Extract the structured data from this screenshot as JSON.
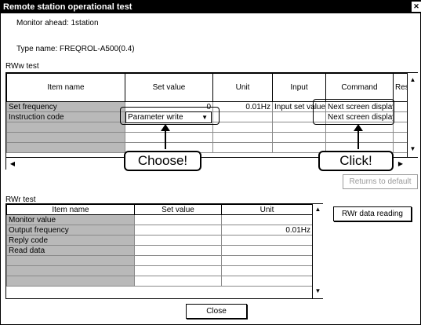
{
  "window": {
    "title": "Remote station operational test",
    "close_glyph": "✕"
  },
  "info": {
    "monitor_ahead": "Monitor ahead:  1station",
    "type_name": "Type name:    FREQROL-A500(0.4)"
  },
  "rww": {
    "section_label": "RWw test",
    "headers": [
      "Item name",
      "Set value",
      "Unit",
      "Input",
      "Command",
      "Res"
    ],
    "rows": [
      {
        "name": "Set frequency",
        "set_value": "0",
        "unit": "0.01Hz",
        "input": "Input set value",
        "command": "Next screen display"
      },
      {
        "name": "Instruction code",
        "set_value": "Parameter write",
        "unit": "",
        "input": "",
        "command": "Next screen display"
      },
      {
        "name": "",
        "set_value": "",
        "unit": "",
        "input": "",
        "command": ""
      },
      {
        "name": "",
        "set_value": "",
        "unit": "",
        "input": "",
        "command": ""
      },
      {
        "name": "",
        "set_value": "",
        "unit": "",
        "input": "",
        "command": ""
      }
    ],
    "returns_button": "Returns to default"
  },
  "callouts": {
    "choose": "Choose!",
    "click": "Click!"
  },
  "rwr": {
    "section_label": "RWr test",
    "headers": [
      "Item name",
      "Set value",
      "Unit"
    ],
    "rows": [
      {
        "name": "Monitor value",
        "set_value": "",
        "unit": ""
      },
      {
        "name": "Output frequency",
        "set_value": "",
        "unit": "0.01Hz"
      },
      {
        "name": "Reply code",
        "set_value": "",
        "unit": ""
      },
      {
        "name": "Read data",
        "set_value": "",
        "unit": ""
      },
      {
        "name": "",
        "set_value": "",
        "unit": ""
      },
      {
        "name": "",
        "set_value": "",
        "unit": ""
      },
      {
        "name": "",
        "set_value": "",
        "unit": ""
      }
    ],
    "read_button": "RWr data reading"
  },
  "footer": {
    "close_button": "Close"
  }
}
